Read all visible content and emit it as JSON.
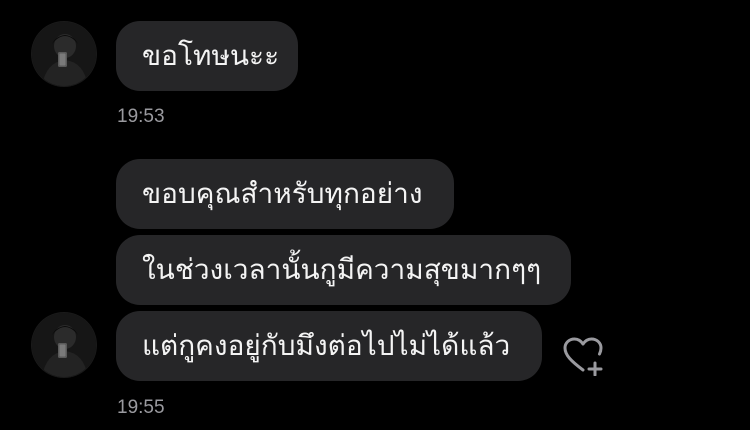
{
  "colors": {
    "background": "#000000",
    "bubble": "#262628",
    "text": "#f4f4f4",
    "timestamp": "#9a9a9f",
    "icon": "#9a9a9f"
  },
  "groups": [
    {
      "messages": [
        {
          "text": "ขอโทษนะะ"
        }
      ],
      "timestamp": "19:53"
    },
    {
      "messages": [
        {
          "text": "ขอบคุณสำหรับทุกอย่าง"
        },
        {
          "text": "ในช่วงเวลานั้นกูมีความสุขมากๆๆ"
        },
        {
          "text": "แต่กูคงอยู่กับมึงต่อไปไม่ได้แล้ว"
        }
      ],
      "timestamp": "19:55",
      "reaction_icon": "heart-add-icon"
    }
  ]
}
